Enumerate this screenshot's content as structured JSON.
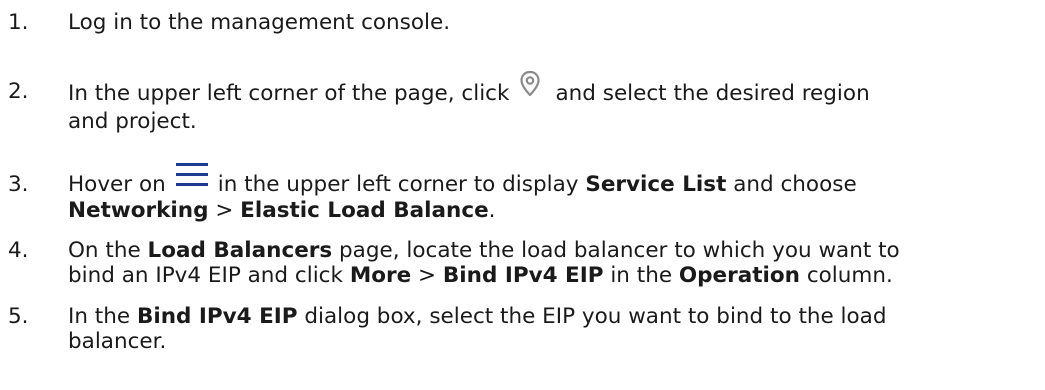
{
  "steps": [
    {
      "num": "1.",
      "text_a": "Log in to the management console."
    },
    {
      "num": "2.",
      "text_a": "In the upper left corner of the page, click",
      "icon": "location-pin-icon",
      "text_b": "and select the desired region",
      "text_c": "and project."
    },
    {
      "num": "3.",
      "text_a": "Hover on",
      "icon": "menu-hamburger-icon",
      "text_b": "in the upper left corner to display",
      "bold_1": "Service List",
      "text_c": "and choose",
      "bold_2": "Networking",
      "sep": ">",
      "bold_3": "Elastic Load Balance",
      "end": "."
    },
    {
      "num": "4.",
      "text_a": "On the",
      "bold_1": "Load Balancers",
      "text_b": "page, locate the load balancer to which you want to",
      "text_c": "bind an IPv4 EIP and click",
      "bold_2": "More",
      "sep": ">",
      "bold_3": "Bind IPv4 EIP",
      "text_d": "in the",
      "bold_4": "Operation",
      "end": "column."
    },
    {
      "num": "5.",
      "text_a": "In the",
      "bold_1": "Bind IPv4 EIP",
      "text_b": "dialog box, select the EIP you want to bind to the load",
      "text_c": "balancer."
    }
  ]
}
